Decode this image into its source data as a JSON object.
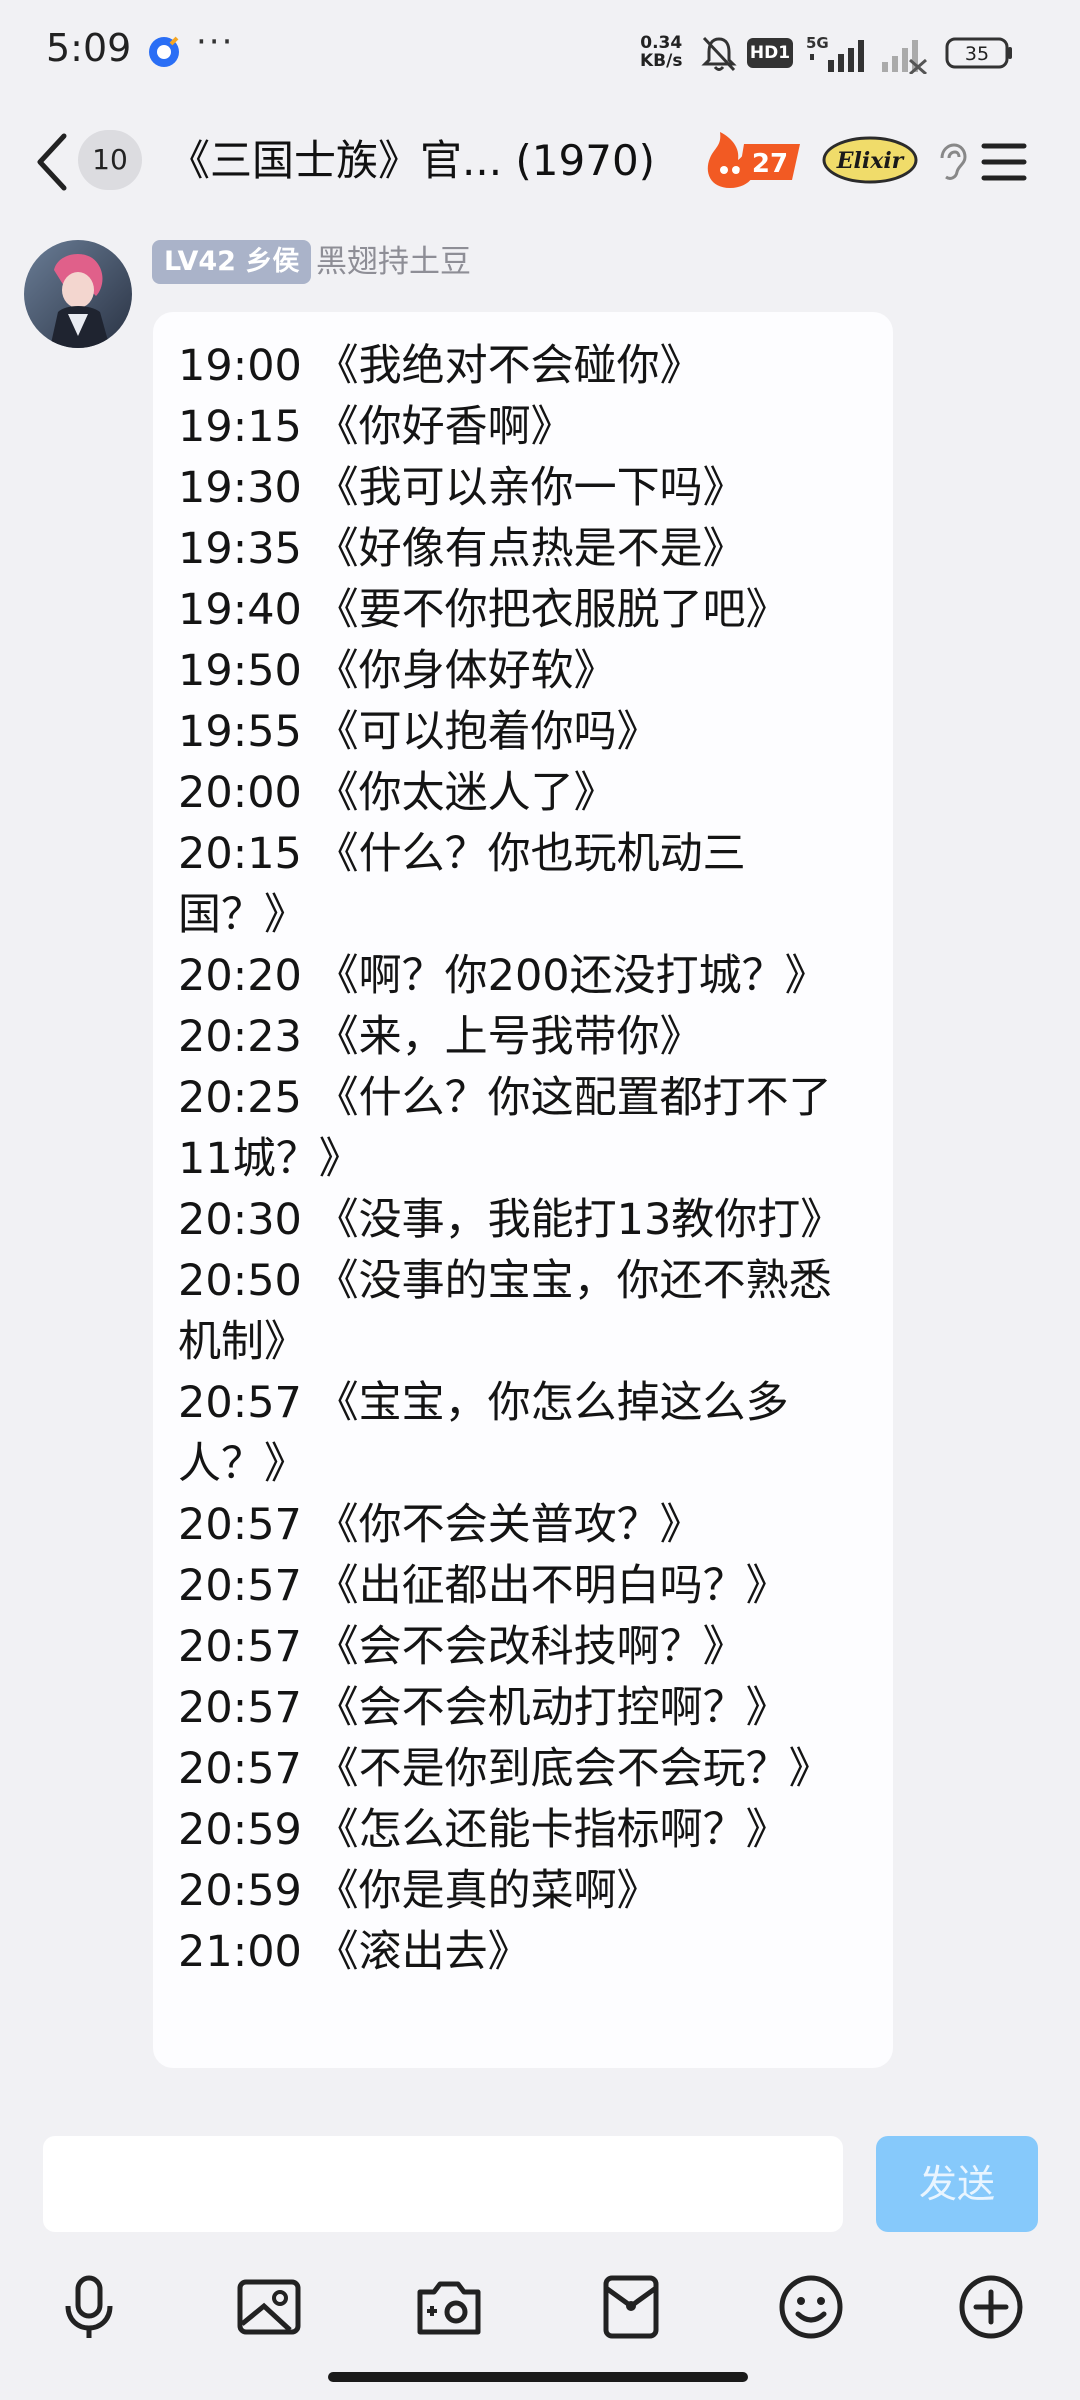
{
  "status_bar": {
    "time": "5:09",
    "more": "···",
    "net_speed_value": "0.34",
    "net_speed_unit": "KB/s",
    "hd_label": "HD1",
    "network_type": "5G",
    "battery": "35",
    "app_icon": "qq-browser-icon",
    "icons": [
      "bell-muted-icon",
      "signal-icon",
      "signal-weak-icon",
      "battery-icon"
    ]
  },
  "header": {
    "unread_count": "10",
    "title": "《三国士族》官... (1970)",
    "fire_badge_count": "27",
    "elixir_label": "Elixir",
    "icons": [
      "back-icon",
      "fire-icon",
      "ear-icon",
      "menu-icon"
    ]
  },
  "message": {
    "level_badge": "LV42 乡侯",
    "sender_name": "黑翅持土豆",
    "lines": [
      "19:00 《我绝对不会碰你》",
      "19:15 《你好香啊》",
      "19:30 《我可以亲你一下吗》",
      "19:35 《好像有点热是不是》",
      "19:40 《要不你把衣服脱了吧》",
      "19:50 《你身体好软》",
      "19:55 《可以抱着你吗》",
      "20:00 《你太迷人了》",
      "20:15 《什么？你也玩机动三",
      "国？》",
      "20:20 《啊？你200还没打城？》",
      "20:23 《来，上号我带你》",
      "20:25 《什么？你这配置都打不了",
      "11城？》",
      "20:30 《没事，我能打13教你打》",
      "20:50 《没事的宝宝，你还不熟悉",
      "机制》",
      "20:57 《宝宝，你怎么掉这么多",
      "人？》",
      "20:57 《你不会关普攻？》",
      "20:57 《出征都出不明白吗？》",
      "20:57 《会不会改科技啊？》",
      "20:57 《会不会机动打控啊？》",
      "20:57 《不是你到底会不会玩？》",
      "20:59 《怎么还能卡指标啊？》",
      "20:59 《你是真的菜啊》",
      "21:00 《滚出去》"
    ]
  },
  "input_bar": {
    "placeholder": "",
    "send_label": "发送",
    "tools": [
      "microphone-icon",
      "image-icon",
      "camera-icon",
      "red-packet-icon",
      "emoji-icon",
      "plus-icon"
    ]
  },
  "colors": {
    "background": "#f1f1f4",
    "bubble": "#fdfdff",
    "send_button": "#86c9fb",
    "level_badge": "#aab3c9",
    "fire": "#f25a23"
  }
}
